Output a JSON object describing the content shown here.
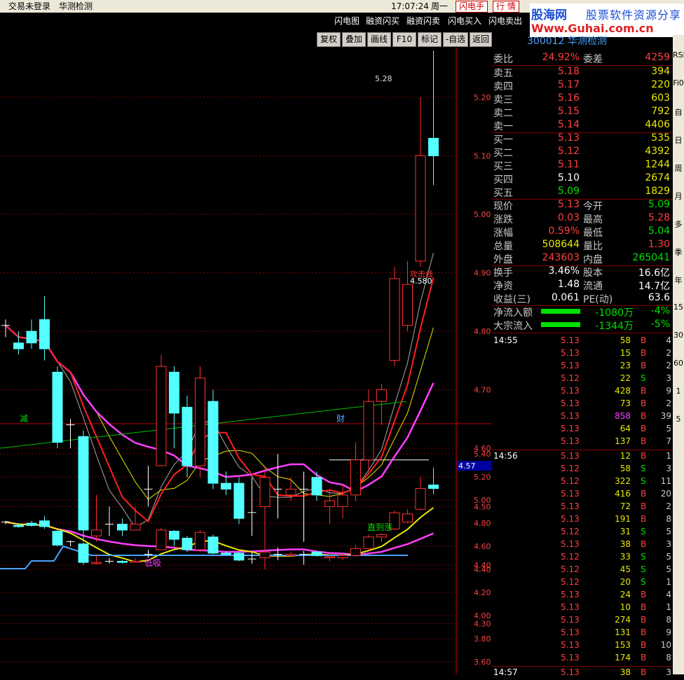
{
  "app": {
    "login_status": "交易未登录",
    "stock_name_top": "华测检测",
    "time": "17:07:24",
    "weekday": "周一",
    "flash_btn": "闪电手",
    "quote_btn": "行 情"
  },
  "logo": {
    "brand": "股海网",
    "slogan": "股票软件资源分享",
    "url": "Www.Guhai.com.cn"
  },
  "menu": [
    "闪电图",
    "融资闪买",
    "融资闪卖",
    "闪电买入",
    "闪电卖出"
  ],
  "toolbar": [
    "复权",
    "叠加",
    "画线",
    "F10",
    "标记",
    "-自选",
    "返回"
  ],
  "stock_title": "300012 华测检测",
  "main_chart": {
    "y_ticks": [
      "5.20",
      "5.10",
      "5.00",
      "4.90",
      "4.80",
      "4.70",
      "4.60",
      "4.50",
      "4.40",
      "4.30",
      "4.20"
    ],
    "high_label": "5.28",
    "current_label": "4.57",
    "line_value": "4.580",
    "line_name": "攻击线",
    "marker_left": "减",
    "marker_right": "财"
  },
  "sub_chart": {
    "y_ticks": [
      "5.40",
      "5.20",
      "5.00",
      "4.80",
      "4.60",
      "4.40",
      "4.20",
      "4.00",
      "3.80",
      "3.60"
    ],
    "label_low": "低吸",
    "label_rise": "直到涨"
  },
  "chart_data": {
    "type": "candlestick",
    "candles": [
      {
        "o": 4.81,
        "c": 4.81,
        "h": 4.82,
        "l": 4.79
      },
      {
        "o": 4.78,
        "c": 4.77,
        "h": 4.8,
        "l": 4.76
      },
      {
        "o": 4.8,
        "c": 4.78,
        "h": 4.82,
        "l": 4.77
      },
      {
        "o": 4.82,
        "c": 4.77,
        "h": 4.86,
        "l": 4.75
      },
      {
        "o": 4.73,
        "c": 4.61,
        "h": 4.74,
        "l": 4.6
      },
      {
        "o": 4.64,
        "c": 4.64,
        "h": 4.65,
        "l": 4.6
      },
      {
        "o": 4.62,
        "c": 4.46,
        "h": 4.63,
        "l": 4.44
      },
      {
        "o": 4.45,
        "c": 4.46,
        "h": 4.52,
        "l": 4.44
      },
      {
        "o": 4.47,
        "c": 4.47,
        "h": 4.5,
        "l": 4.45
      },
      {
        "o": 4.47,
        "c": 4.46,
        "h": 4.48,
        "l": 4.45
      },
      {
        "o": 4.46,
        "c": 4.47,
        "h": 4.5,
        "l": 4.46
      },
      {
        "o": 4.53,
        "c": 4.53,
        "h": 4.57,
        "l": 4.5
      },
      {
        "o": 4.57,
        "c": 4.74,
        "h": 4.76,
        "l": 4.57
      },
      {
        "o": 4.73,
        "c": 4.66,
        "h": 4.74,
        "l": 4.6
      },
      {
        "o": 4.67,
        "c": 4.57,
        "h": 4.69,
        "l": 4.55
      },
      {
        "o": 4.57,
        "c": 4.72,
        "h": 4.74,
        "l": 4.55
      },
      {
        "o": 4.68,
        "c": 4.54,
        "h": 4.7,
        "l": 4.53
      },
      {
        "o": 4.54,
        "c": 4.53,
        "h": 4.56,
        "l": 4.52
      },
      {
        "o": 4.54,
        "c": 4.48,
        "h": 4.55,
        "l": 4.47
      },
      {
        "o": 4.49,
        "c": 4.49,
        "h": 4.55,
        "l": 4.45
      },
      {
        "o": 4.5,
        "c": 4.55,
        "h": 4.57,
        "l": 4.4
      },
      {
        "o": 4.53,
        "c": 4.53,
        "h": 4.59,
        "l": 4.48
      },
      {
        "o": 4.52,
        "c": 4.53,
        "h": 4.55,
        "l": 4.51
      },
      {
        "o": 4.53,
        "c": 4.53,
        "h": 4.56,
        "l": 4.44
      },
      {
        "o": 4.55,
        "c": 4.52,
        "h": 4.56,
        "l": 4.51
      },
      {
        "o": 4.5,
        "c": 4.51,
        "h": 4.53,
        "l": 4.47
      },
      {
        "o": 4.5,
        "c": 4.52,
        "h": 4.54,
        "l": 4.48
      },
      {
        "o": 4.52,
        "c": 4.58,
        "h": 4.61,
        "l": 4.51
      },
      {
        "o": 4.58,
        "c": 4.68,
        "h": 4.7,
        "l": 4.56
      },
      {
        "o": 4.68,
        "c": 4.7,
        "h": 4.71,
        "l": 4.64
      },
      {
        "o": 4.75,
        "c": 4.89,
        "h": 4.91,
        "l": 4.74
      },
      {
        "o": 4.81,
        "c": 4.88,
        "h": 4.92,
        "l": 4.8
      },
      {
        "o": 4.92,
        "c": 5.1,
        "h": 5.2,
        "l": 4.91
      },
      {
        "o": 5.13,
        "c": 5.1,
        "h": 5.28,
        "l": 5.05
      }
    ]
  },
  "quote": {
    "weibi_label": "委比",
    "weibi": "24.92%",
    "weicha_label": "委差",
    "weicha": "4259",
    "asks": [
      {
        "label": "卖五",
        "price": "5.18",
        "vol": "394"
      },
      {
        "label": "卖四",
        "price": "5.17",
        "vol": "220"
      },
      {
        "label": "卖三",
        "price": "5.16",
        "vol": "603"
      },
      {
        "label": "卖二",
        "price": "5.15",
        "vol": "792"
      },
      {
        "label": "卖一",
        "price": "5.14",
        "vol": "4406"
      }
    ],
    "bids": [
      {
        "label": "买一",
        "price": "5.13",
        "vol": "535",
        "cls": "red"
      },
      {
        "label": "买二",
        "price": "5.12",
        "vol": "4392",
        "cls": "red"
      },
      {
        "label": "买三",
        "price": "5.11",
        "vol": "1244",
        "cls": "red"
      },
      {
        "label": "买四",
        "price": "5.10",
        "vol": "2674",
        "cls": "white"
      },
      {
        "label": "买五",
        "price": "5.09",
        "vol": "1829",
        "cls": "green"
      }
    ],
    "stats": [
      {
        "l": "现价",
        "v": "5.13",
        "vc": "red",
        "n": "今开",
        "w": "5.09",
        "wc": "green"
      },
      {
        "l": "涨跌",
        "v": "0.03",
        "vc": "red",
        "n": "最高",
        "w": "5.28",
        "wc": "red"
      },
      {
        "l": "涨幅",
        "v": "0.59%",
        "vc": "red",
        "n": "最低",
        "w": "5.04",
        "wc": "green"
      },
      {
        "l": "总量",
        "v": "508644",
        "vc": "yellow",
        "n": "量比",
        "w": "1.30",
        "wc": "red"
      },
      {
        "l": "外盘",
        "v": "243603",
        "vc": "red",
        "n": "内盘",
        "w": "265041",
        "wc": "green"
      }
    ],
    "stats2": [
      {
        "l": "换手",
        "v": "3.46%",
        "n": "股本",
        "w": "16.6亿"
      },
      {
        "l": "净资",
        "v": "1.48",
        "n": "流通",
        "w": "14.7亿"
      },
      {
        "l": "收益(三)",
        "v": "0.061",
        "n": "PE(动)",
        "w": "63.6"
      }
    ],
    "flows": [
      {
        "l": "净流入额",
        "v": "-1080万",
        "p": "-4%"
      },
      {
        "l": "大宗流入",
        "v": "-1344万",
        "p": "-5%"
      }
    ]
  },
  "ticks": [
    {
      "t": "14:55",
      "p": "5.13",
      "v": "58",
      "s": "B",
      "c": "4"
    },
    {
      "t": "",
      "p": "5.13",
      "v": "15",
      "s": "B",
      "c": "2"
    },
    {
      "t": "",
      "p": "5.13",
      "v": "23",
      "s": "B",
      "c": "2"
    },
    {
      "t": "",
      "p": "5.12",
      "v": "22",
      "s": "S",
      "c": "3"
    },
    {
      "t": "",
      "p": "5.13",
      "v": "428",
      "s": "B",
      "c": "9"
    },
    {
      "t": "",
      "p": "5.13",
      "v": "73",
      "s": "B",
      "c": "2"
    },
    {
      "t": "",
      "p": "5.13",
      "v": "858",
      "s": "B",
      "c": "39"
    },
    {
      "t": "",
      "p": "5.13",
      "v": "64",
      "s": "B",
      "c": "5"
    },
    {
      "t": "",
      "p": "5.13",
      "v": "137",
      "s": "B",
      "c": "7"
    },
    {
      "t": "14:56",
      "p": "5.13",
      "v": "12",
      "s": "B",
      "c": "1"
    },
    {
      "t": "",
      "p": "5.12",
      "v": "58",
      "s": "S",
      "c": "3"
    },
    {
      "t": "",
      "p": "5.12",
      "v": "322",
      "s": "S",
      "c": "11"
    },
    {
      "t": "",
      "p": "5.13",
      "v": "416",
      "s": "B",
      "c": "20"
    },
    {
      "t": "",
      "p": "5.13",
      "v": "72",
      "s": "B",
      "c": "2"
    },
    {
      "t": "",
      "p": "5.13",
      "v": "191",
      "s": "B",
      "c": "8"
    },
    {
      "t": "",
      "p": "5.12",
      "v": "31",
      "s": "S",
      "c": "5"
    },
    {
      "t": "",
      "p": "5.13",
      "v": "38",
      "s": "B",
      "c": "3"
    },
    {
      "t": "",
      "p": "5.12",
      "v": "33",
      "s": "S",
      "c": "5"
    },
    {
      "t": "",
      "p": "5.12",
      "v": "45",
      "s": "S",
      "c": "5"
    },
    {
      "t": "",
      "p": "5.12",
      "v": "20",
      "s": "S",
      "c": "1"
    },
    {
      "t": "",
      "p": "5.13",
      "v": "24",
      "s": "B",
      "c": "4"
    },
    {
      "t": "",
      "p": "5.13",
      "v": "10",
      "s": "B",
      "c": "1"
    },
    {
      "t": "",
      "p": "5.13",
      "v": "274",
      "s": "B",
      "c": "8"
    },
    {
      "t": "",
      "p": "5.13",
      "v": "131",
      "s": "B",
      "c": "9"
    },
    {
      "t": "",
      "p": "5.13",
      "v": "153",
      "s": "B",
      "c": "10"
    },
    {
      "t": "",
      "p": "5.13",
      "v": "174",
      "s": "B",
      "c": "8"
    },
    {
      "t": "14:57",
      "p": "5.13",
      "v": "38",
      "s": "B",
      "c": "3"
    }
  ],
  "right_strip": [
    "RSI",
    "Fi0",
    "自",
    "日",
    "周",
    "月",
    "多",
    "季",
    "年",
    "15",
    "30",
    "60",
    "1",
    "5"
  ],
  "colors": {
    "up": "#ff3030",
    "down": "#54ffff",
    "ma5": "#ffffff",
    "ma10": "#e8e800",
    "ma20": "#ff40ff",
    "ma60": "#00c000",
    "grid": "#800000"
  }
}
